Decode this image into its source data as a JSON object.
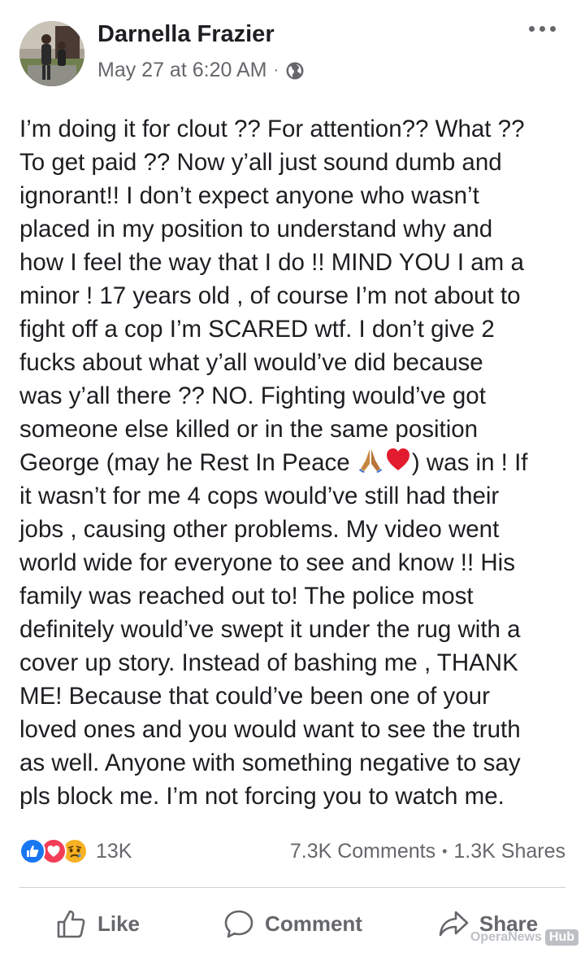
{
  "post": {
    "author": "Darnella Frazier",
    "timestamp": "May 27 at 6:20 AM",
    "separator": "·",
    "lines": [
      "I’m doing it for clout ?? For attention?? What ??",
      "To get paid ?? Now y’all just sound dumb and",
      "ignorant!! I don’t expect anyone who wasn’t",
      "placed in my position to understand why and",
      "how I feel the way that I do !! MIND YOU I am a",
      "minor ! 17 years old , of course I’m not about to",
      "fight off a cop I’m SCARED wtf. I don’t give 2",
      "fucks about what y’all would’ve did because",
      "was y’all there ?? NO. Fighting would’ve got",
      "someone else killed or in the same position",
      "George (may he Rest In Peace ",
      ") was in ! If",
      "it wasn’t for me 4 cops would’ve still had their",
      "jobs , causing other problems. My video went",
      "world wide for everyone to see and know !! His",
      "family was reached out to! The police most",
      "definitely would’ve swept it under the rug with a",
      "cover up story. Instead of bashing me , THANK",
      "ME! Because that could’ve been one of your",
      "loved ones and you would want to see the truth",
      "as well. Anyone with something negative to say",
      "pls block me. I’m not forcing you to watch me."
    ]
  },
  "stats": {
    "reactions_count": "13K",
    "comments": "7.3K Comments",
    "shares": "1.3K Shares",
    "separator": "•"
  },
  "actions": {
    "like": "Like",
    "comment": "Comment",
    "share": "Share"
  },
  "watermark": {
    "text": "OperaNews",
    "badge": "Hub"
  },
  "colors": {
    "like_blue": "#1877f2",
    "love_red": "#f33e58",
    "sad_yellow": "#f7b125",
    "muted_text": "#65676b"
  },
  "icons": {
    "more": "more-horizontal-icon",
    "audience": "globe-icon",
    "like": "thumbs-up-icon",
    "comment": "speech-bubble-icon",
    "share": "share-arrow-icon"
  }
}
